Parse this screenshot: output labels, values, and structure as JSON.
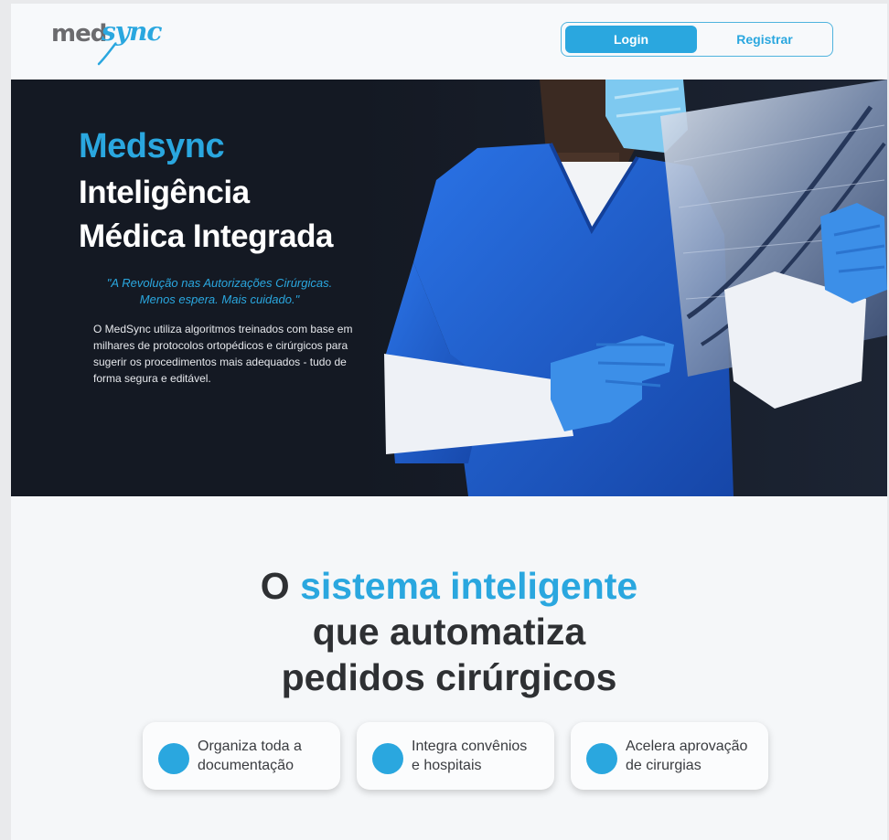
{
  "header": {
    "logo": {
      "part1": "med",
      "part2": "sync"
    },
    "login_label": "Login",
    "register_label": "Registrar"
  },
  "hero": {
    "brand": "Medsync",
    "title_line1": "Inteligência",
    "title_line2": "Médica Integrada",
    "quote_line1": "\"A Revolução nas Autorizações Cirúrgicas.",
    "quote_line2": "Menos espera. Mais cuidado.\"",
    "description": "O MedSync utiliza algoritmos treinados com base em milhares de protocolos ortopédicos e cirúrgicos para sugerir os procedimentos mais adequados - tudo de forma segura e editável."
  },
  "section": {
    "title_lead": "O ",
    "title_accent": "sistema inteligente",
    "title_line2": "que automatiza",
    "title_line3": "pedidos cirúrgicos"
  },
  "features": [
    {
      "line1": "Organiza toda a",
      "line2": "documentação"
    },
    {
      "line1": "Integra convênios",
      "line2": "e hospitais"
    },
    {
      "line1": "Acelera aprovação",
      "line2": "de cirurgias"
    }
  ],
  "colors": {
    "accent": "#2aa7df",
    "hero_bg": "#141923",
    "scrubs": "#1e5fd0",
    "text_dark": "#2e3033"
  },
  "icons": {
    "hero_image": "doctor-xray-illustration",
    "feature_bullet": "blue-circle-icon"
  }
}
